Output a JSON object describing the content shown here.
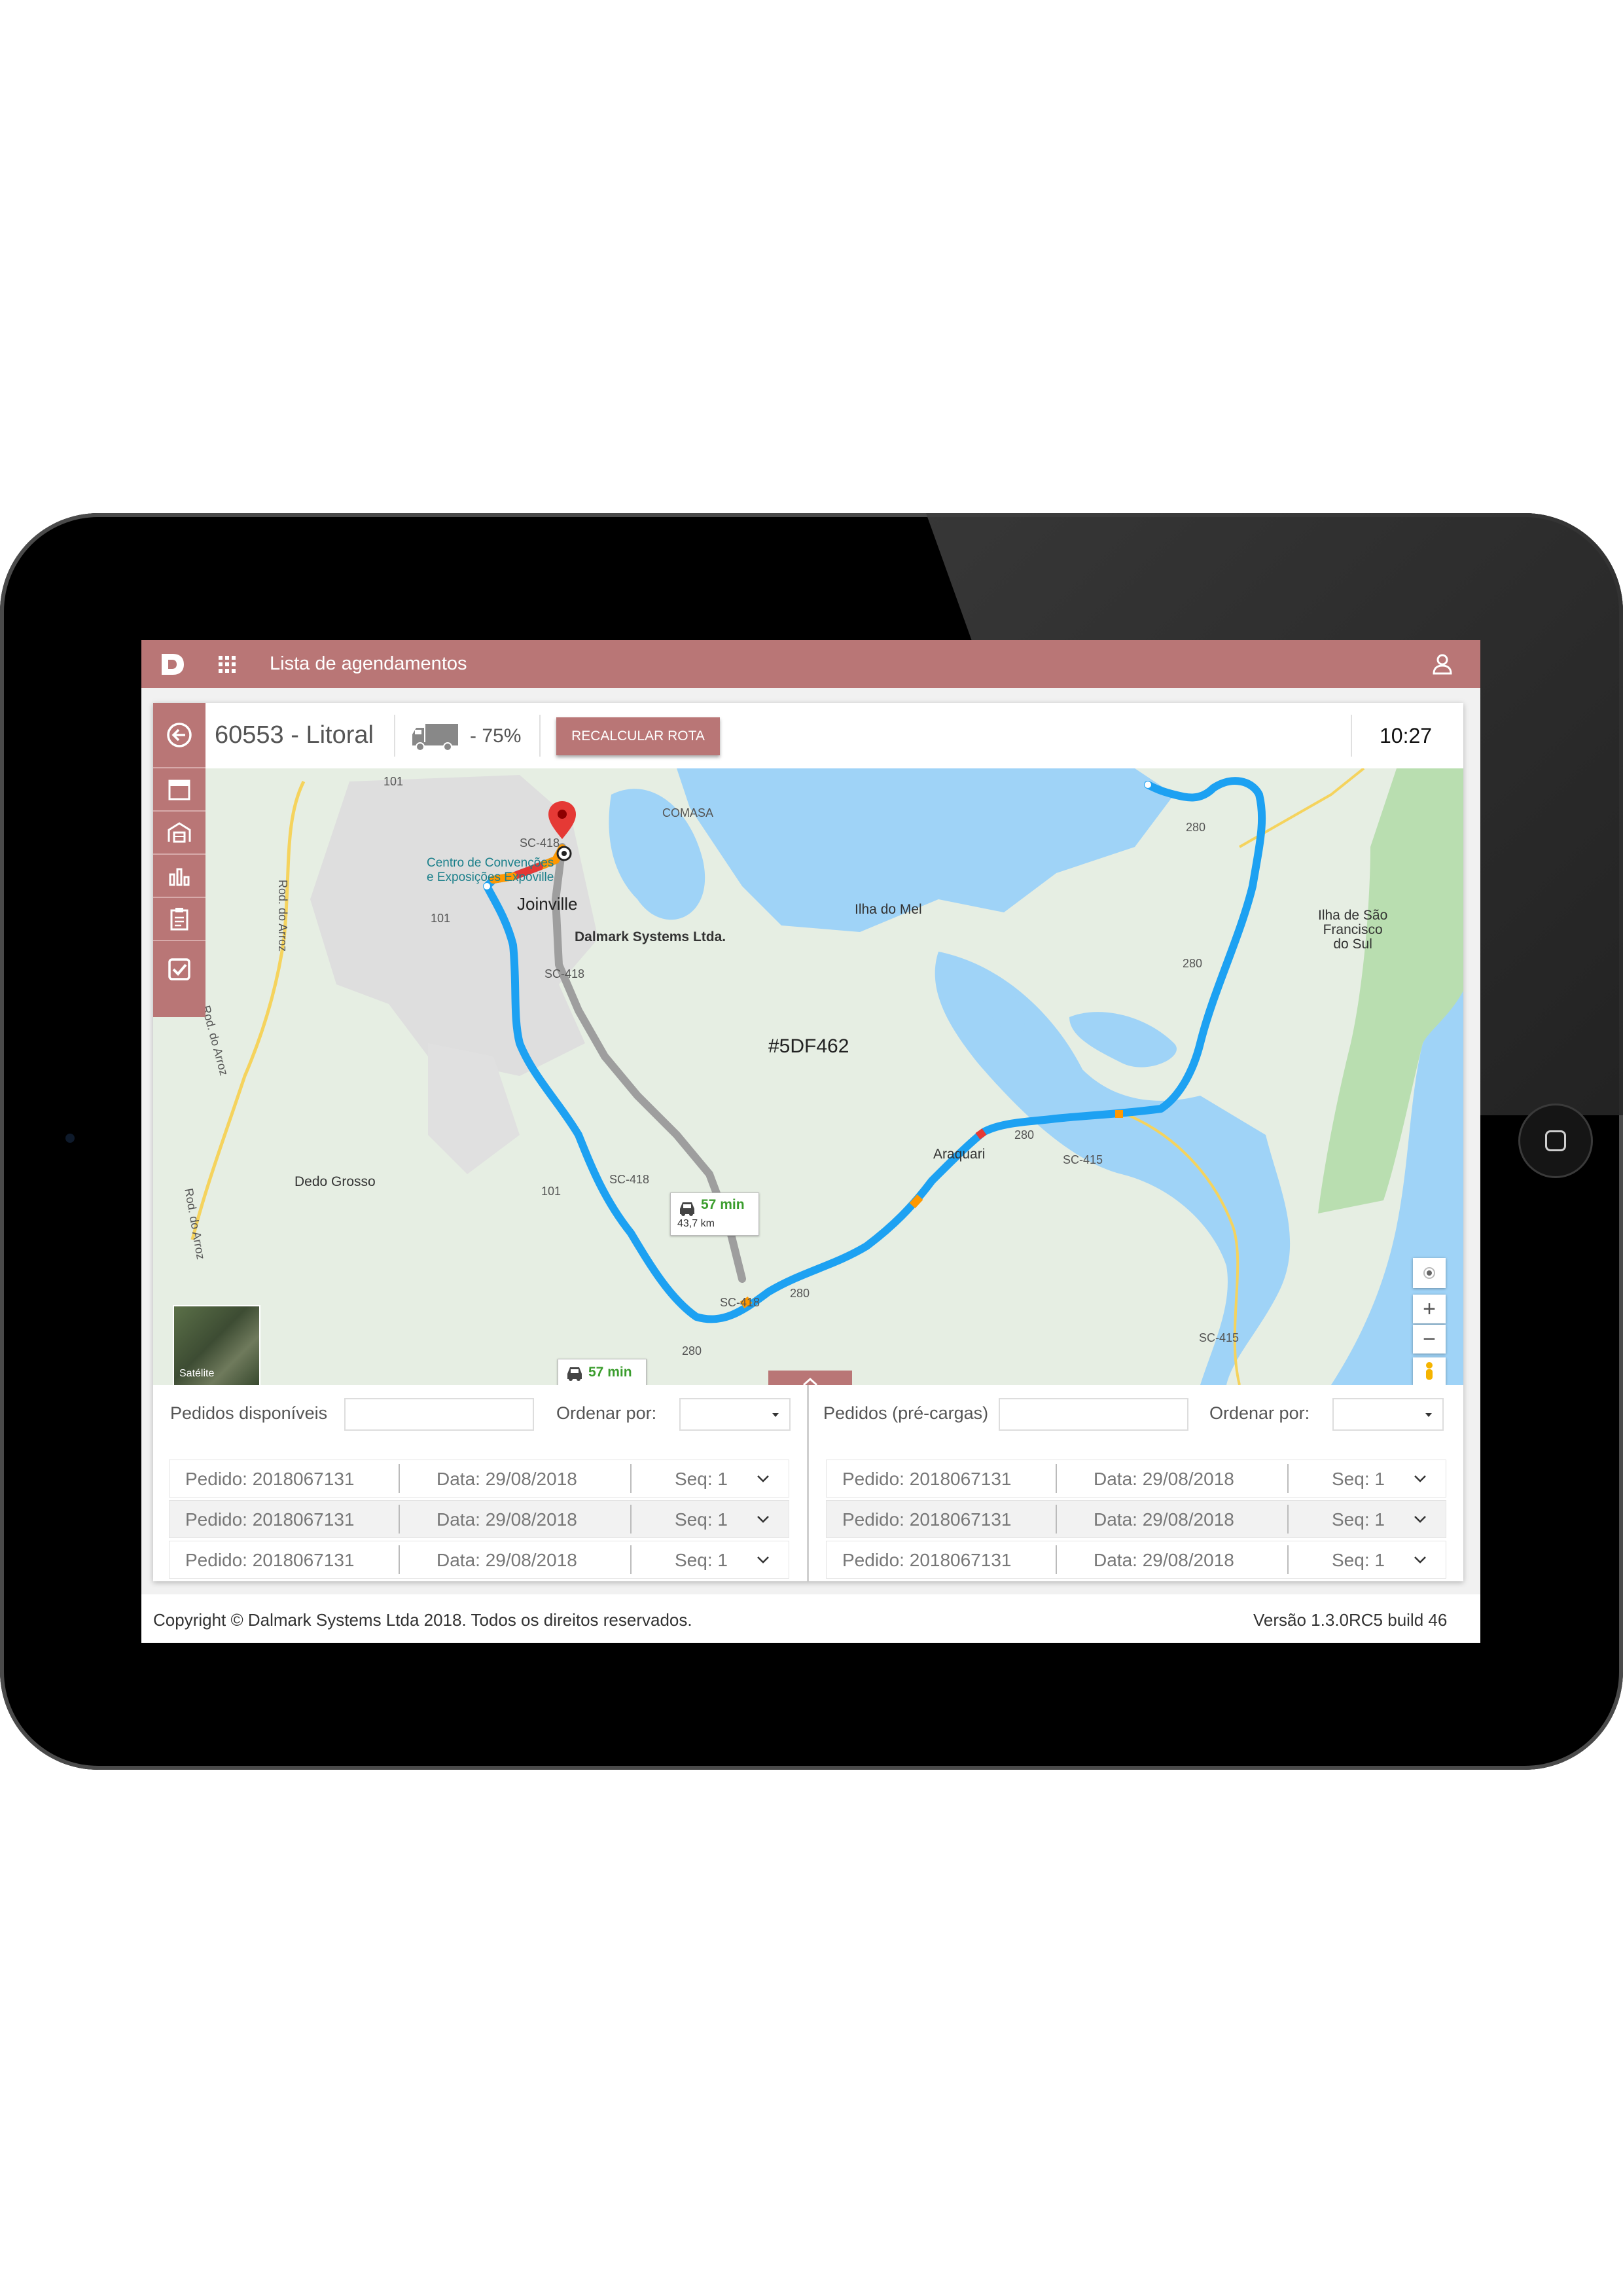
{
  "app": {
    "title": "Lista de agendamentos",
    "accent_color": "#b97676"
  },
  "header": {
    "route_title": "60553 - Litoral",
    "load_icon": "truck-icon",
    "load_value": "- 75%",
    "recalc_label": "RECALCULAR ROTA",
    "time": "10:27"
  },
  "sidebar": {
    "items": [
      {
        "icon": "back-arrow-icon"
      },
      {
        "icon": "calendar-icon"
      },
      {
        "icon": "warehouse-icon"
      },
      {
        "icon": "bar-chart-icon"
      },
      {
        "icon": "clipboard-icon"
      },
      {
        "icon": "checkbox-icon"
      }
    ]
  },
  "map": {
    "vehicle_label": "#5DF462",
    "company_label": "Dalmark Systems Ltda.",
    "city": "Joinville",
    "poi": [
      "Centro de Convenções",
      "e Exposições Expoville"
    ],
    "places": {
      "comasa": "COMASA",
      "ilha_mel": "Ilha do Mel",
      "ilha_sao": [
        "Ilha de São",
        "Francisco",
        "do Sul"
      ],
      "dedo": "Dedo Grosso",
      "araquari": "Araquari",
      "rod_arroz": "Rod. do Arroz",
      "rod_arroz2": "Rod. do Arroz",
      "rod_arroz3": "Rod. do Arroz"
    },
    "roads": {
      "sc418_a": "SC-418",
      "sc418_b": "SC-418",
      "sc418_c": "SC-418",
      "sc418_d": "SC-418",
      "r101_a": "101",
      "r101_b": "101",
      "r101_c": "101",
      "r280_a": "280",
      "r280_b": "280",
      "r280_c": "280",
      "r280_d": "280",
      "r280_e": "280",
      "sc415_a": "SC-415",
      "sc415_b": "SC-415"
    },
    "bubble_main": {
      "time": "57 min",
      "distance": "43,7 km"
    },
    "bubble_bottom": {
      "time": "57 min"
    },
    "satellite_label": "Satélite",
    "zoom_in": "+",
    "zoom_out": "−",
    "route_color": "#1da1f2"
  },
  "left_list": {
    "title": "Pedidos disponíveis",
    "sort_label": "Ordenar por:",
    "rows": [
      {
        "pedido": "Pedido: 2018067131",
        "data": "Data: 29/08/2018",
        "seq": "Seq: 1"
      },
      {
        "pedido": "Pedido: 2018067131",
        "data": "Data: 29/08/2018",
        "seq": "Seq: 1"
      },
      {
        "pedido": "Pedido: 2018067131",
        "data": "Data: 29/08/2018",
        "seq": "Seq: 1"
      }
    ]
  },
  "right_list": {
    "title": "Pedidos (pré-cargas)",
    "sort_label": "Ordenar por:",
    "rows": [
      {
        "pedido": "Pedido: 2018067131",
        "data": "Data: 29/08/2018",
        "seq": "Seq: 1"
      },
      {
        "pedido": "Pedido: 2018067131",
        "data": "Data: 29/08/2018",
        "seq": "Seq: 1"
      },
      {
        "pedido": "Pedido: 2018067131",
        "data": "Data: 29/08/2018",
        "seq": "Seq: 1"
      }
    ]
  },
  "footer": {
    "copyright": "Copyright © Dalmark Systems Ltda 2018. Todos os direitos reservados.",
    "version": "Versão 1.3.0RC5 build 46"
  }
}
